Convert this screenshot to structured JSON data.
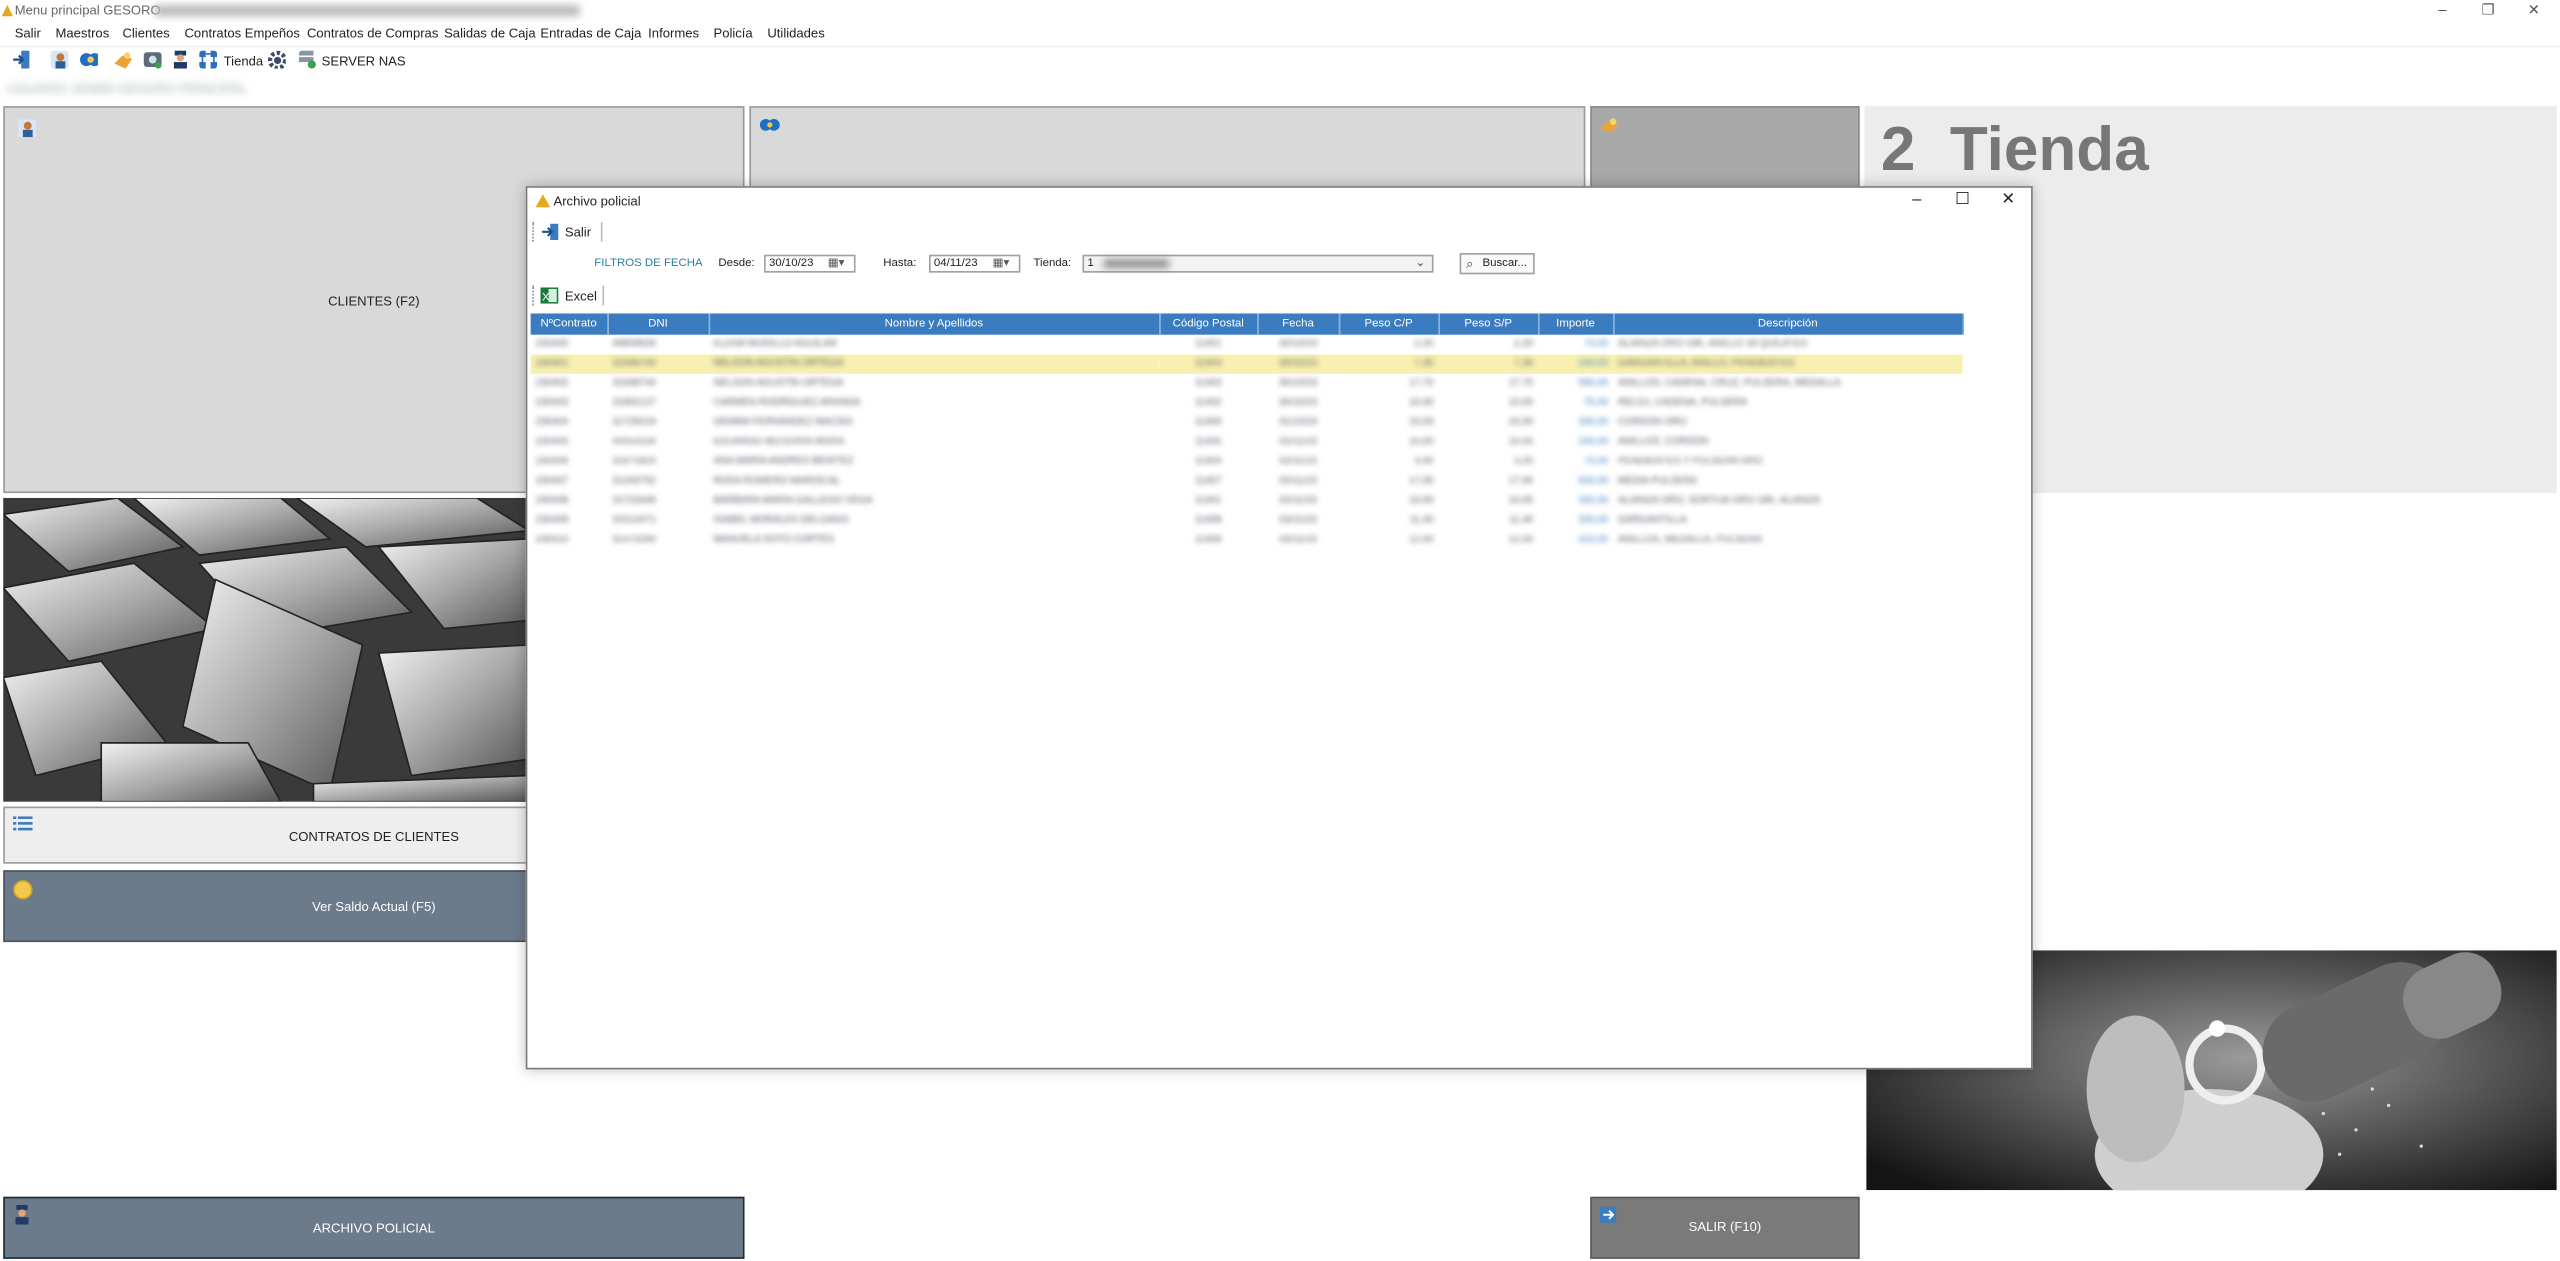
{
  "window": {
    "title": "Menu principal GESORO"
  },
  "menu": [
    "Salir",
    "Maestros",
    "Clientes",
    "Contratos Empeños",
    "Contratos de Compras",
    "Salidas de Caja",
    "Entradas de Caja",
    "Informes",
    "Policía",
    "Utilidades"
  ],
  "toolbar": {
    "tienda_label": "Tienda",
    "server_label": "SERVER NAS"
  },
  "user_line": "USUARIO: ADMIN GESORO PRINCIPAL",
  "panels": {
    "clientes": "CLIENTES (F2)",
    "contratos_clientes": "CONTRATOS DE CLIENTES",
    "saldo": "Ver Saldo Actual (F5)",
    "archivo_policial": "ARCHIVO POLICIAL",
    "salir": "SALIR (F10)",
    "tienda_number": "2",
    "tienda_name": "Tienda"
  },
  "dialog": {
    "title": "Archivo policial",
    "salir_label": "Salir",
    "filters_label": "FILTROS DE FECHA",
    "desde_label": "Desde:",
    "desde_value": "30/10/23",
    "hasta_label": "Hasta:",
    "hasta_value": "04/11/23",
    "tienda_label": "Tienda:",
    "tienda_value": "1",
    "buscar_label": "Buscar...",
    "excel_label": "Excel",
    "columns": [
      "NºContrato",
      "DNI",
      "Nombre y Apellidos",
      "Código Postal",
      "Fecha",
      "Peso C/P",
      "Peso S/P",
      "Importe",
      "Descripción"
    ],
    "rows": [
      [
        "230400",
        "48808839",
        "ELENA MORILLO AGUILAR",
        "11401",
        "30/10/23",
        "2,20",
        "2,20",
        "70,00",
        "ALIANZA ORO 18K, ANILLO 18 QUILATES"
      ],
      [
        "230401",
        "31668744",
        "NELSON AGUSTÍN ORTEGA",
        "11403",
        "30/10/23",
        "7,30",
        "7,30",
        "240,00",
        "GARGANTILLA, ANILLO, PENDIENTES"
      ],
      [
        "230402",
        "31668744",
        "NELSON AGUSTÍN ORTEGA",
        "11403",
        "30/10/23",
        "17,70",
        "17,70",
        "590,00",
        "ANILLOS, CADENA, CRUZ, PULSERA, MEDALLA"
      ],
      [
        "230403",
        "31862127",
        "CARMEN RODRÍGUEZ ARANDA",
        "11402",
        "30/10/23",
        "10,00",
        "10,00",
        "75,00",
        "RELOJ, CADENA, PULSERA"
      ],
      [
        "230404",
        "31729219",
        "GEMMA FERNÁNDEZ MACÍAS",
        "11406",
        "31/10/23",
        "10,00",
        "10,00",
        "330,00",
        "CORDÓN ORO"
      ],
      [
        "230405",
        "44314154",
        "EDUARDO BECERRA MORA",
        "11405",
        "02/11/23",
        "10,00",
        "10,00",
        "330,00",
        "ANILLOS, CORDÓN"
      ],
      [
        "230406",
        "31671824",
        "ANA MARÍA ANDRÉS BENÍTEZ",
        "11404",
        "02/11/23",
        "3,00",
        "3,20",
        "70,00",
        "PENDIENTES Y PULSERA ORO"
      ],
      [
        "230407",
        "31343752",
        "ROSA ROMERO MARISCAL",
        "11407",
        "02/11/23",
        "17,00",
        "17,00",
        "600,00",
        "MEDIA PULSERA"
      ],
      [
        "230408",
        "31722649",
        "BÁRBARA MARÍA GALLEGO VEGA",
        "11401",
        "02/11/23",
        "10,00",
        "10,00",
        "330,00",
        "ALIANZA ORO, SORTIJA ORO 18K, ALIANZA"
      ],
      [
        "230409",
        "31514471",
        "ISABEL MORALES DELGADO",
        "11408",
        "03/11/23",
        "11,40",
        "11,40",
        "330,00",
        "GARGANTILLA"
      ],
      [
        "230410",
        "31473284",
        "MANUELA SOTO CORTÉS",
        "11408",
        "03/11/23",
        "12,00",
        "12,00",
        "420,00",
        "ANILLOS, MEDALLA, PULSERA"
      ]
    ]
  },
  "colors": {
    "header_blue": "#3b7bbf",
    "selected_row": "#f7f0b0",
    "dark_button": "#6c7b8b"
  },
  "icons": [
    "exit-icon",
    "clients-icon",
    "contracts-icon",
    "hands-gold-icon",
    "cash-icon",
    "police-icon",
    "network-icon",
    "gear-icon",
    "server-icon",
    "excel-icon",
    "search-icon",
    "calendar-icon",
    "coin-icon",
    "list-icon"
  ]
}
